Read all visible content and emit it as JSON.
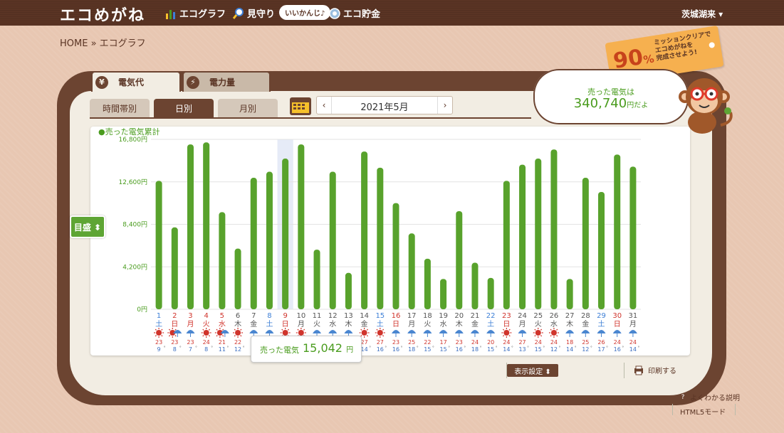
{
  "header": {
    "logo": "エコめがね",
    "nav": [
      {
        "label": "エコグラフ",
        "icon": "bar-graph-icon"
      },
      {
        "label": "見守り",
        "icon": "magnifier-icon"
      },
      {
        "label": "エコ貯金",
        "icon": "coin-icon"
      }
    ],
    "badge": "いいかんじ♪",
    "user": "茨城湖来 ▾"
  },
  "breadcrumb": "HOME » エコグラフ",
  "mission": {
    "percent": "90",
    "unit": "%",
    "text_l1": "ミッションクリアで",
    "text_l2": "エコめがねを",
    "text_l3": "完成させよう!"
  },
  "tabs": {
    "cost": "電気代",
    "power": "電力量"
  },
  "subtabs": {
    "hour": "時間帯別",
    "day": "日別",
    "month": "月別"
  },
  "date": {
    "label": "2021年5月",
    "prev": "‹",
    "next": "›"
  },
  "bubble": {
    "line1": "売った電気は",
    "value": "340,740",
    "suffix": "円だよ"
  },
  "scale_button": "目盛 ⬍",
  "tooltip": {
    "label": "売った電気",
    "value": "15,042",
    "unit": "円"
  },
  "controls": {
    "display": "表示設定 ⬍",
    "print": "印刷する",
    "help": "よくわかる説明",
    "html5": "HTML5モード"
  },
  "colors": {
    "bar": "#58a22c",
    "sat": "#3d7fd6",
    "sun": "#d0342c",
    "brown": "#6c4431"
  },
  "chart_data": {
    "type": "bar",
    "series_label": "●売った電気累計",
    "ylim": [
      0,
      16800
    ],
    "yticks": [
      "16,800円",
      "12,600円",
      "8,400円",
      "4,200円",
      "0円"
    ],
    "ytick_values": [
      16800,
      12600,
      8400,
      4200,
      0
    ],
    "grid": true,
    "days": [
      "1",
      "2",
      "3",
      "4",
      "5",
      "6",
      "7",
      "8",
      "9",
      "10",
      "11",
      "12",
      "13",
      "14",
      "15",
      "16",
      "17",
      "18",
      "19",
      "20",
      "21",
      "22",
      "23",
      "24",
      "25",
      "26",
      "27",
      "28",
      "29",
      "30",
      "31"
    ],
    "weekdays": [
      "土",
      "日",
      "月",
      "火",
      "水",
      "木",
      "金",
      "土",
      "日",
      "月",
      "火",
      "水",
      "木",
      "金",
      "土",
      "日",
      "月",
      "火",
      "水",
      "木",
      "金",
      "土",
      "日",
      "月",
      "火",
      "水",
      "木",
      "金",
      "土",
      "日",
      "月"
    ],
    "day_colors": [
      "sat",
      "sun",
      "sun",
      "sun",
      "sun",
      "",
      "",
      "sat",
      "sun",
      "",
      "",
      "",
      "",
      "",
      "sat",
      "sun",
      "",
      "",
      "",
      "",
      "",
      "sat",
      "sun",
      "",
      "",
      "",
      "",
      "",
      "sat",
      "sun",
      ""
    ],
    "values": [
      12700,
      8100,
      16300,
      16500,
      9600,
      6000,
      13000,
      13600,
      14900,
      16300,
      5900,
      13600,
      3600,
      15600,
      14000,
      10500,
      7500,
      5000,
      3000,
      9700,
      4600,
      3100,
      12700,
      14300,
      14900,
      15800,
      3000,
      13000,
      11600,
      15300,
      14100
    ],
    "highlight_index": 8,
    "weather": [
      "sun",
      "sun-umbrella",
      "umbrella",
      "sun",
      "sun-umbrella",
      "sun",
      "umbrella",
      "umbrella",
      "sun",
      "sun",
      "umbrella",
      "umbrella",
      "umbrella",
      "sun",
      "sun",
      "umbrella",
      "umbrella",
      "umbrella",
      "umbrella",
      "umbrella",
      "umbrella",
      "umbrella",
      "sun",
      "umbrella",
      "sun",
      "sun",
      "umbrella",
      "umbrella",
      "umbrella",
      "umbrella",
      "umbrella"
    ],
    "temp_high": [
      "23",
      "23",
      "23",
      "24",
      "21",
      "22",
      "19",
      "21",
      "23",
      "23",
      "23",
      "27",
      "22",
      "27",
      "27",
      "23",
      "25",
      "22",
      "17",
      "23",
      "24",
      "20",
      "24",
      "27",
      "24",
      "24",
      "18",
      "25",
      "26",
      "24",
      "24"
    ],
    "temp_low": [
      "9",
      "8",
      "7",
      "8",
      "11",
      "12",
      "11",
      "12",
      "11",
      "12",
      "12",
      "12",
      "11",
      "14",
      "16",
      "16",
      "18",
      "15",
      "15",
      "16",
      "18",
      "15",
      "14",
      "13",
      "15",
      "12",
      "14",
      "12",
      "17",
      "16",
      "14"
    ]
  }
}
